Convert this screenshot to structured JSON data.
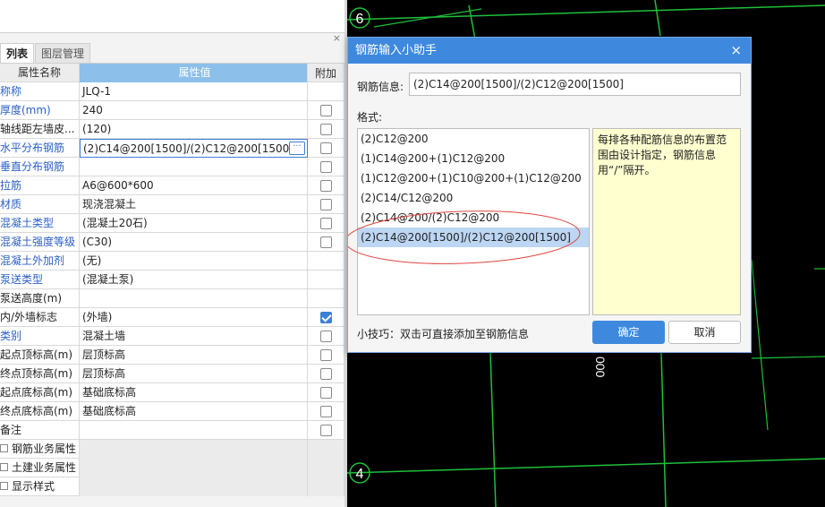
{
  "panel": {
    "close_glyph": "×",
    "tabs": [
      "列表",
      "图层管理"
    ],
    "columns": {
      "name": "属性名称",
      "value": "属性值",
      "add": "附加"
    },
    "rows": [
      {
        "name": "称称",
        "value": "JLQ-1",
        "color": "blue",
        "checkbox": "none"
      },
      {
        "name": "厚度(mm)",
        "value": "240",
        "color": "blue",
        "checkbox": "off"
      },
      {
        "name": "轴线距左墙皮...",
        "value": "(120)",
        "color": "black",
        "checkbox": "off"
      },
      {
        "name": "水平分布钢筋",
        "value": "(2)C14@200[1500]/(2)C12@200[1500]",
        "color": "blue",
        "checkbox": "off",
        "selected": true
      },
      {
        "name": "垂直分布钢筋",
        "value": "",
        "color": "blue",
        "checkbox": "off"
      },
      {
        "name": "拉筋",
        "value": "A6@600*600",
        "color": "blue",
        "checkbox": "off"
      },
      {
        "name": "材质",
        "value": "现浇混凝土",
        "color": "blue",
        "checkbox": "off"
      },
      {
        "name": "混凝土类型",
        "value": "(混凝土20石)",
        "color": "blue",
        "checkbox": "off"
      },
      {
        "name": "混凝土强度等级",
        "value": "(C30)",
        "color": "blue",
        "checkbox": "off"
      },
      {
        "name": "混凝土外加剂",
        "value": "(无)",
        "color": "blue",
        "checkbox": "none"
      },
      {
        "name": "泵送类型",
        "value": "(混凝土泵)",
        "color": "blue",
        "checkbox": "none"
      },
      {
        "name": "泵送高度(m)",
        "value": "",
        "color": "black",
        "checkbox": "none"
      },
      {
        "name": "内/外墙标志",
        "value": "(外墙)",
        "color": "black",
        "checkbox": "on"
      },
      {
        "name": "类别",
        "value": "混凝土墙",
        "color": "blue",
        "checkbox": "off"
      },
      {
        "name": "起点顶标高(m)",
        "value": "层顶标高",
        "color": "black",
        "checkbox": "off"
      },
      {
        "name": "终点顶标高(m)",
        "value": "层顶标高",
        "color": "black",
        "checkbox": "off"
      },
      {
        "name": "起点底标高(m)",
        "value": "基础底标高",
        "color": "black",
        "checkbox": "off"
      },
      {
        "name": "终点底标高(m)",
        "value": "基础底标高",
        "color": "black",
        "checkbox": "off"
      },
      {
        "name": "备注",
        "value": "",
        "color": "black",
        "checkbox": "off"
      }
    ],
    "groups": [
      "钢筋业务属性",
      "土建业务属性",
      "显示样式"
    ],
    "ellipsis": "···"
  },
  "dialog": {
    "title": "钢筋输入小助手",
    "close_glyph": "×",
    "info_label": "钢筋信息:",
    "info_value": "(2)C14@200[1500]/(2)C12@200[1500]",
    "format_label": "格式:",
    "formats": [
      "(2)C12@200",
      "(1)C14@200+(1)C12@200",
      "(1)C12@200+(1)C10@200+(1)C12@200",
      "(2)C14/C12@200",
      "(2)C14@200/(2)C12@200",
      "(2)C14@200[1500]/(2)C12@200[1500]"
    ],
    "selected_format_index": 5,
    "tip": "每排各种配筋信息的布置范围由设计指定，钢筋信息用“/”隔开。",
    "hint": "小技巧：双击可直接添加至钢筋信息",
    "ok_label": "确定",
    "cancel_label": "取消"
  },
  "canvas": {
    "axis_labels": [
      "6",
      "4"
    ],
    "dim_text": "000"
  },
  "colors": {
    "accent": "#3e89de",
    "grid_line": "#1fbf3a",
    "canvas_bg": "#000000",
    "tip_bg": "#ffffd0",
    "selection": "#bcd6f3",
    "annotation": "#e0463f"
  }
}
